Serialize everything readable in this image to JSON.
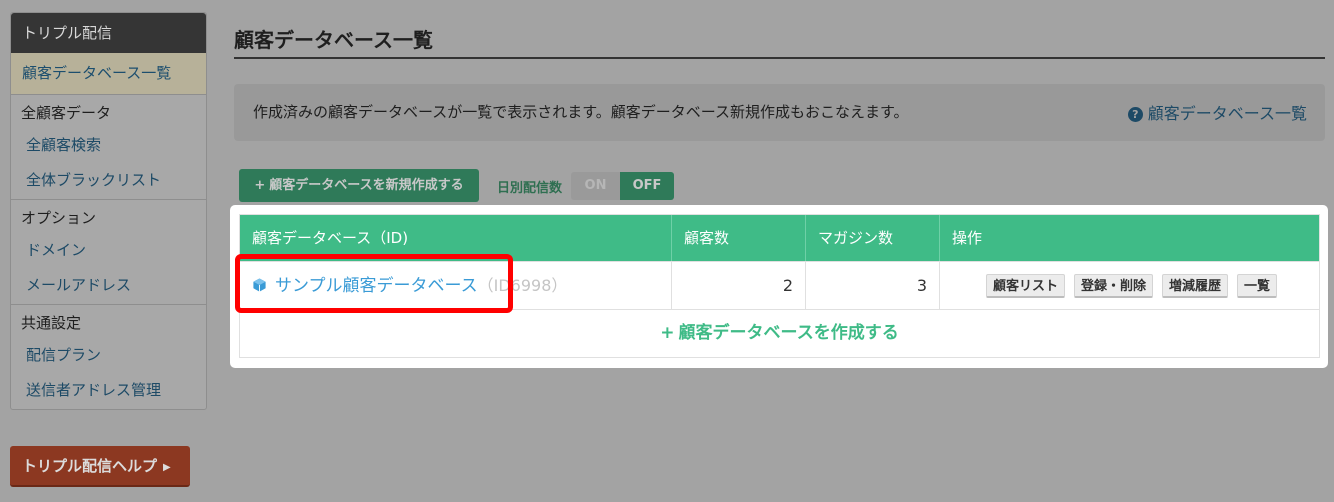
{
  "sidebar": {
    "header": "トリプル配信",
    "active_item": "顧客データベース一覧",
    "groups": [
      {
        "title": "全顧客データ",
        "items": [
          "全顧客検索",
          "全体ブラックリスト"
        ]
      },
      {
        "title": "オプション",
        "items": [
          "ドメイン",
          "メールアドレス"
        ]
      },
      {
        "title": "共通設定",
        "items": [
          "配信プラン",
          "送信者アドレス管理"
        ]
      }
    ],
    "help_button": "トリプル配信ヘルプ"
  },
  "main": {
    "title": "顧客データベース一覧",
    "info_text": "作成済みの顧客データベースが一覧で表示されます。顧客データベース新規作成もおこなえます。",
    "info_link": "顧客データベース一覧",
    "create_button": "顧客データベースを新規作成する",
    "daily_label": "日別配信数",
    "toggle_on": "ON",
    "toggle_off": "OFF",
    "table": {
      "headers": [
        "顧客データベース（ID)",
        "顧客数",
        "マガジン数",
        "操作"
      ],
      "rows": [
        {
          "name": "サンプル顧客データベース",
          "id_text": "（ID6998）",
          "customers": "2",
          "magazines": "3",
          "actions": [
            "顧客リスト",
            "登録・削除",
            "増減履歴",
            "一覧"
          ]
        }
      ],
      "footer_link": "顧客データベースを作成する"
    }
  },
  "colors": {
    "accent_green": "#3fbb87",
    "highlight_red": "#ff0000",
    "link_blue": "#3a9bd6"
  }
}
